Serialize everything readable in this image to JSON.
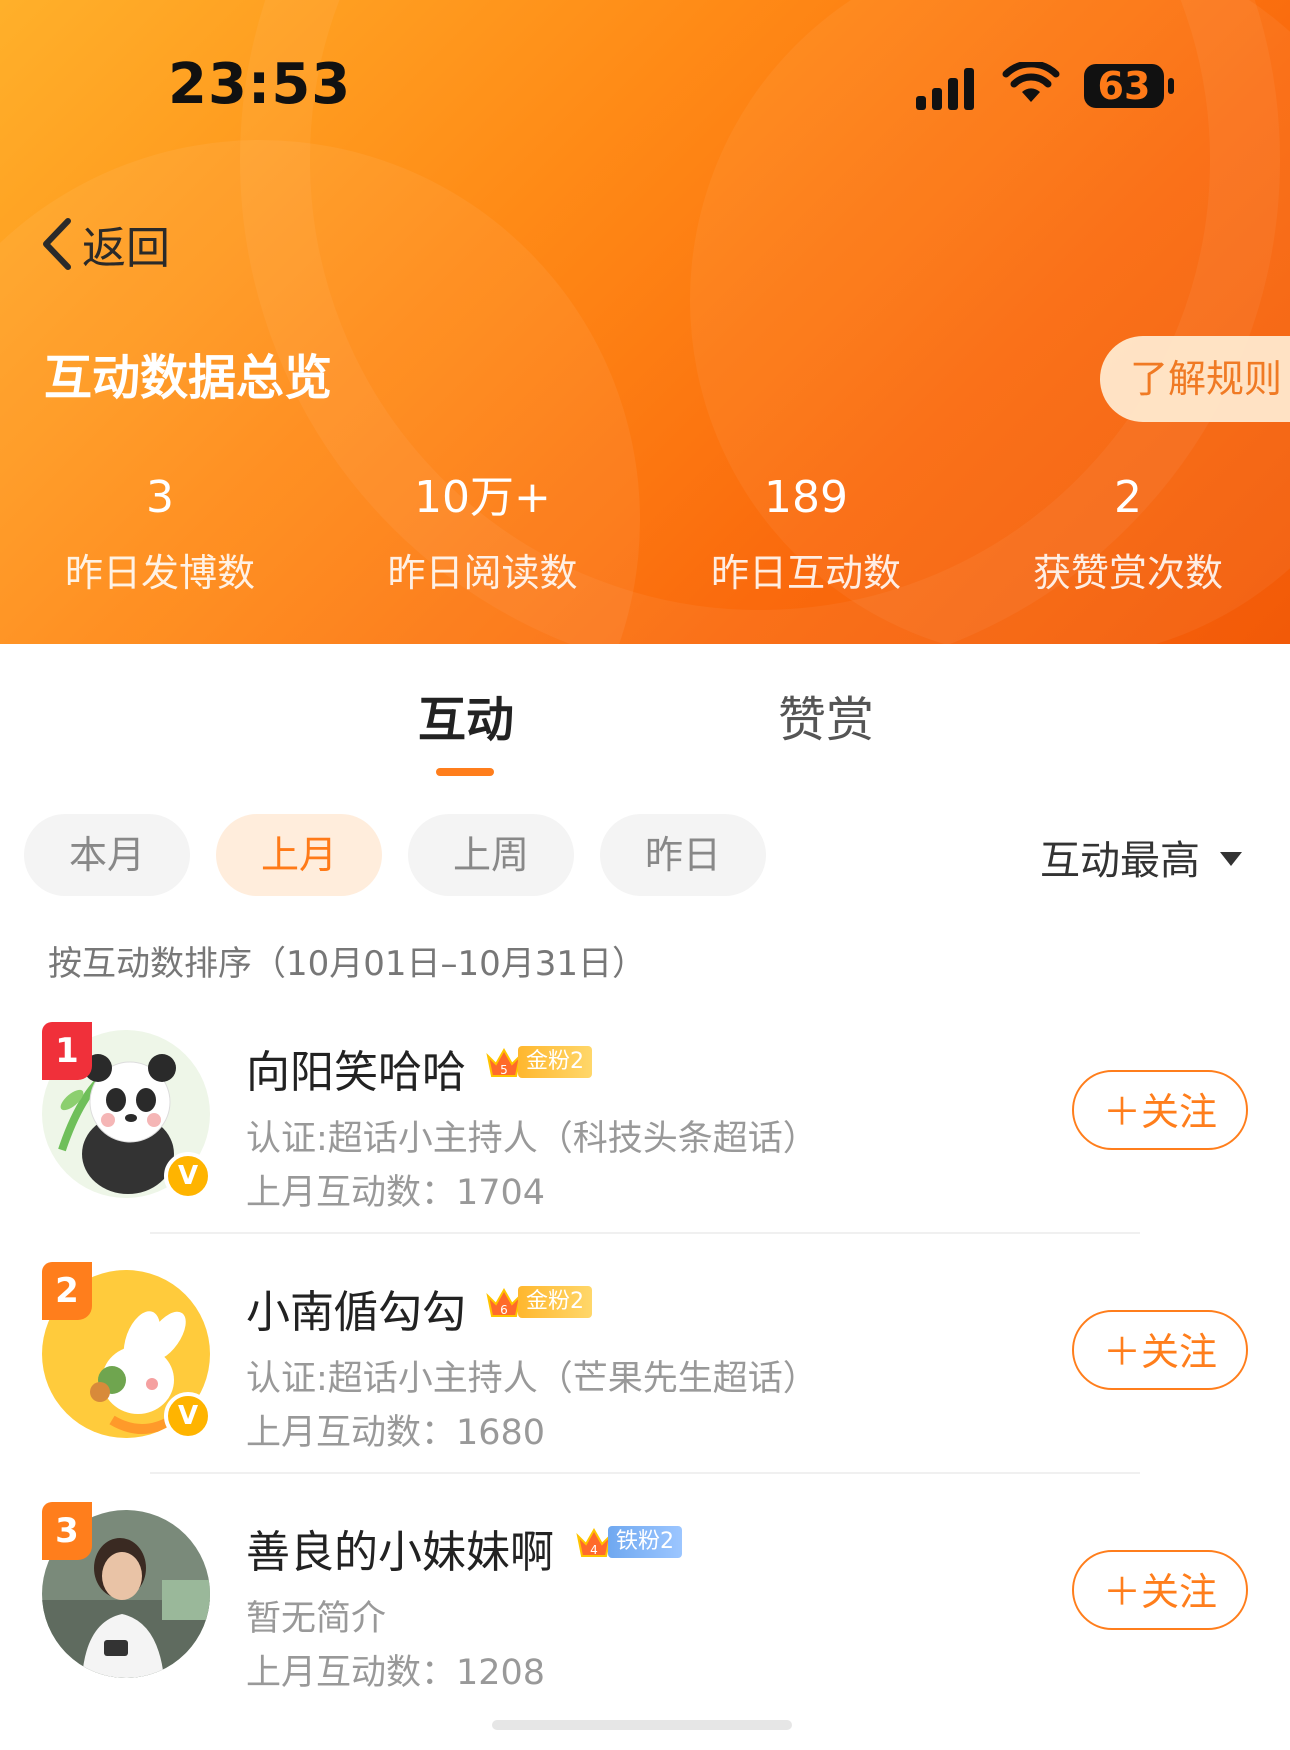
{
  "status_bar": {
    "time": "23:53",
    "battery": "63"
  },
  "header": {
    "back_label": "返回",
    "title": "互动数据总览",
    "rules_label": "了解规则",
    "stats": [
      {
        "value": "3",
        "label": "昨日发博数"
      },
      {
        "value": "10万+",
        "label": "昨日阅读数"
      },
      {
        "value": "189",
        "label": "昨日互动数"
      },
      {
        "value": "2",
        "label": "获赞赏次数"
      }
    ]
  },
  "tabs": [
    {
      "label": "互动",
      "active": true
    },
    {
      "label": "赞赏",
      "active": false
    }
  ],
  "filters": {
    "periods": [
      "本月",
      "上月",
      "上周",
      "昨日"
    ],
    "active_period": "上月",
    "sort_label": "互动最高"
  },
  "range_text": "按互动数排序（10月01日–10月31日）",
  "users": [
    {
      "rank": "1",
      "name": "向阳笑哈哈",
      "fan_level_num": "5",
      "fan_label": "金粉2",
      "fan_type": "gold",
      "desc": "认证:超话小主持人（科技头条超话）",
      "count": "上月互动数：1704",
      "follow": "＋关注"
    },
    {
      "rank": "2",
      "name": "小南偱勾勾",
      "fan_level_num": "6",
      "fan_label": "金粉2",
      "fan_type": "gold",
      "desc": "认证:超话小主持人（芒果先生超话）",
      "count": "上月互动数：1680",
      "follow": "＋关注"
    },
    {
      "rank": "3",
      "name": "善良的小妹妹啊",
      "fan_level_num": "4",
      "fan_label": "铁粉2",
      "fan_type": "iron",
      "desc": "暂无简介",
      "count": "上月互动数：1208",
      "follow": "＋关注"
    }
  ],
  "colors": {
    "accent": "#ff7e1c",
    "header_start": "#ffb02a",
    "header_end": "#f25a08",
    "rank1": "#f0303a"
  }
}
